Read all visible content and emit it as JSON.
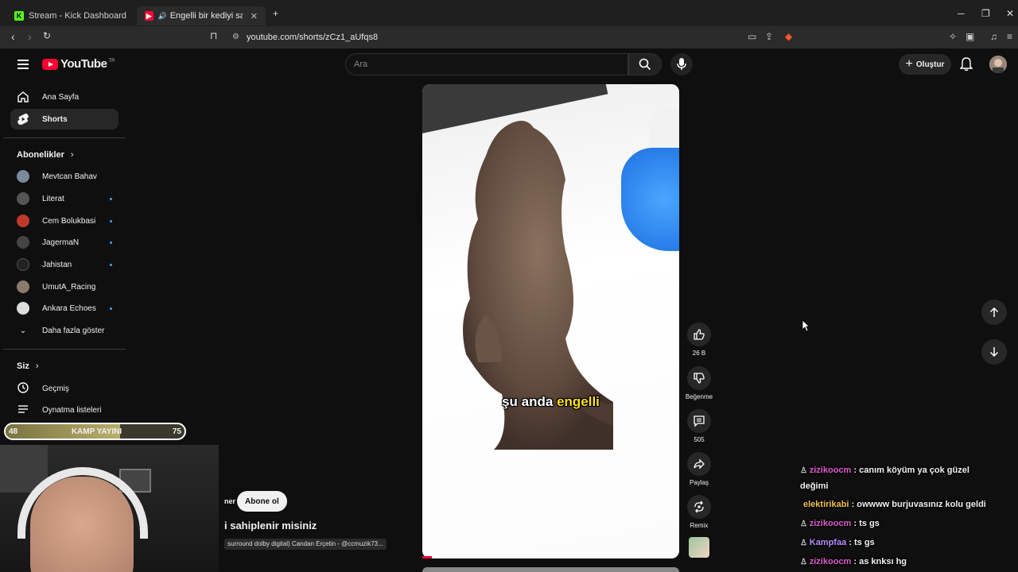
{
  "browser": {
    "tabs": [
      {
        "label": "Stream - Kick Dashboard",
        "active": false
      },
      {
        "label": "Engelli bir kediyi sahiplenir mi",
        "active": true
      }
    ],
    "url": "youtube.com/shorts/zCz1_aUfqs8"
  },
  "youtube": {
    "logo_text": "YouTube",
    "logo_country": "TR",
    "search_placeholder": "Ara",
    "create_label": "Oluştur"
  },
  "sidebar": {
    "items": [
      {
        "label": "Ana Sayfa",
        "icon": "home-icon",
        "active": false
      },
      {
        "label": "Shorts",
        "icon": "shorts-icon",
        "active": true
      }
    ],
    "subscriptions_title": "Abonelikler",
    "subscriptions": [
      {
        "name": "Mevtcan Bahav",
        "dot": false,
        "color": "#7a8a9a"
      },
      {
        "name": "Literat",
        "dot": true,
        "color": "#555555"
      },
      {
        "name": "Cem Bolukbasi",
        "dot": true,
        "color": "#c0392b"
      },
      {
        "name": "JagermaN",
        "dot": true,
        "color": "#444444"
      },
      {
        "name": "Jahistan",
        "dot": true,
        "color": "#222222"
      },
      {
        "name": "UmutA_Racing",
        "dot": false,
        "color": "#8a7a6a"
      },
      {
        "name": "Ankara Echoes",
        "dot": true,
        "color": "#dddddd"
      }
    ],
    "show_more": "Daha fazla göster",
    "you_title": "Siz",
    "you_items": [
      {
        "label": "Geçmiş",
        "icon": "history-icon"
      },
      {
        "label": "Oynatma listeleri",
        "icon": "playlist-icon"
      }
    ]
  },
  "overlay": {
    "left_value": "48",
    "label": "KAMP YAYINI",
    "right_value": "75",
    "fill_fraction": 0.64
  },
  "short": {
    "channel_partial": "ner",
    "subscribe_label": "Abone ol",
    "title_partial": "i sahiplenir misiniz",
    "music": "surround dolby digital) Candan Erçetin - @ccmuzik73...",
    "caption_a": "şu anda",
    "caption_b": "engelli"
  },
  "actions": {
    "likes": "26 B",
    "dislike": "Beğenme",
    "comments": "505",
    "share": "Paylaş",
    "remix": "Remix"
  },
  "chat": [
    {
      "user": "zizikoocm",
      "color": "#e05bd0",
      "text": ": canım köyüm ya çok güzel",
      "badge": true
    },
    {
      "user": "",
      "color": "#ffffff",
      "text": "değimi",
      "badge": false
    },
    {
      "user": "elektirikabi",
      "color": "#f2c14e",
      "text": ": owwww burjuvasınız kolu geldi",
      "badge": false
    },
    {
      "user": "zizikoocm",
      "color": "#e05bd0",
      "text": ": ts gs",
      "badge": true
    },
    {
      "user": "Kampfaa",
      "color": "#b78cff",
      "text": ": ts gs",
      "badge": true
    },
    {
      "user": "zizikoocm",
      "color": "#e05bd0",
      "text": ": as knksı hg",
      "badge": true
    }
  ]
}
